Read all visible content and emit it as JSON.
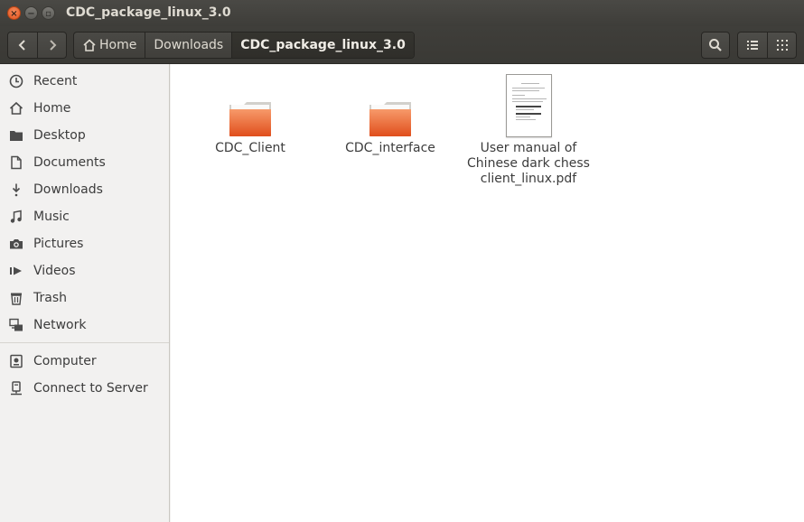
{
  "window": {
    "title": "CDC_package_linux_3.0",
    "buttons": {
      "close": "×",
      "minimize": "−",
      "maximize": "▫"
    }
  },
  "header": {
    "back_icon": "chevron-left-icon",
    "forward_icon": "chevron-right-icon",
    "breadcrumbs": [
      "Home",
      "Downloads",
      "CDC_package_linux_3.0"
    ],
    "search_icon": "search-icon",
    "list_view_icon": "list-view-icon",
    "grid_view_icon": "grid-view-icon"
  },
  "sidebar": {
    "items": [
      {
        "label": "Recent",
        "icon": "clock-icon"
      },
      {
        "label": "Home",
        "icon": "home-icon"
      },
      {
        "label": "Desktop",
        "icon": "desktop-folder-icon"
      },
      {
        "label": "Documents",
        "icon": "document-icon"
      },
      {
        "label": "Downloads",
        "icon": "download-icon"
      },
      {
        "label": "Music",
        "icon": "music-icon"
      },
      {
        "label": "Pictures",
        "icon": "camera-icon"
      },
      {
        "label": "Videos",
        "icon": "video-icon"
      },
      {
        "label": "Trash",
        "icon": "trash-icon"
      },
      {
        "label": "Network",
        "icon": "network-icon"
      }
    ],
    "devices": [
      {
        "label": "Computer",
        "icon": "computer-icon"
      },
      {
        "label": "Connect to Server",
        "icon": "server-icon"
      }
    ]
  },
  "files": [
    {
      "name": "CDC_Client",
      "type": "folder"
    },
    {
      "name": "CDC_interface",
      "type": "folder"
    },
    {
      "name_lines": [
        "User manual of",
        "Chinese dark chess",
        "client_linux.pdf"
      ],
      "type": "pdf"
    }
  ],
  "colors": {
    "titlebar": "#3e3d39",
    "folder": "#e95d26",
    "close_button": "#e2531f",
    "sidebar_bg": "#f2f1f0",
    "content_bg": "#ffffff"
  }
}
